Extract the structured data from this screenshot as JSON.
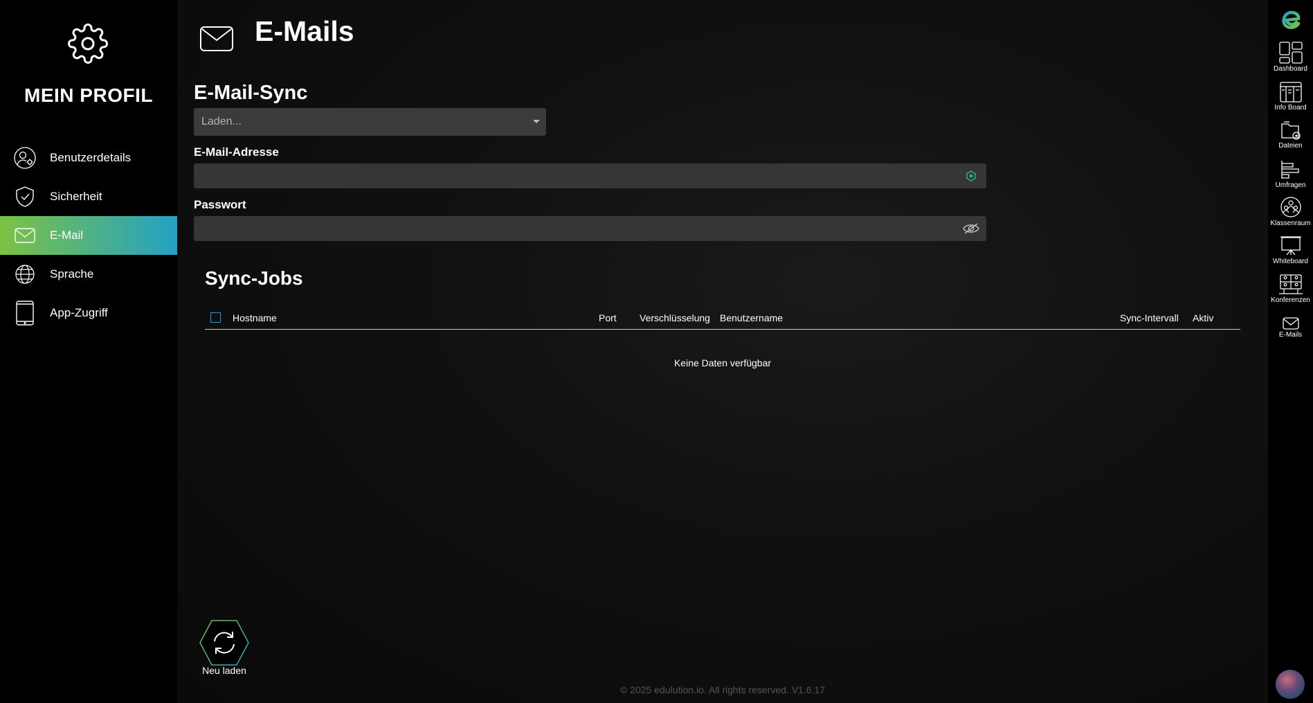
{
  "sidebar": {
    "title": "MEIN PROFIL",
    "items": [
      {
        "label": "Benutzerdetails",
        "icon": "user-gear-icon"
      },
      {
        "label": "Sicherheit",
        "icon": "shield-check-icon"
      },
      {
        "label": "E-Mail",
        "icon": "mail-icon",
        "active": true
      },
      {
        "label": "Sprache",
        "icon": "globe-icon"
      },
      {
        "label": "App-Zugriff",
        "icon": "tablet-icon"
      }
    ]
  },
  "header": {
    "title": "E-Mails",
    "icon": "mail-icon"
  },
  "email_sync": {
    "title": "E-Mail-Sync",
    "select_value": "Laden...",
    "email_label": "E-Mail-Adresse",
    "email_value": "",
    "password_label": "Passwort",
    "password_value": ""
  },
  "sync_jobs": {
    "title": "Sync-Jobs",
    "columns": [
      "Hostname",
      "Port",
      "Verschlüsselung",
      "Benutzername",
      "Sync-Intervall",
      "Aktiv"
    ],
    "empty_message": "Keine Daten verfügbar"
  },
  "reload_button": {
    "label": "Neu laden",
    "icon": "refresh-icon"
  },
  "footer": "© 2025 edulution.io. All rights reserved. V1.6.17",
  "rail": {
    "items": [
      {
        "label": "Dashboard",
        "icon": "dashboard-icon"
      },
      {
        "label": "Info Board",
        "icon": "info-board-icon"
      },
      {
        "label": "Dateien",
        "icon": "files-icon"
      },
      {
        "label": "Umfragen",
        "icon": "surveys-icon"
      },
      {
        "label": "Klassenraum",
        "icon": "classroom-icon"
      },
      {
        "label": "Whiteboard",
        "icon": "whiteboard-icon"
      },
      {
        "label": "Konferenzen",
        "icon": "conferences-icon"
      },
      {
        "label": "E-Mails",
        "icon": "mail-icon"
      }
    ]
  },
  "colors": {
    "accent_start": "#7cc242",
    "accent_end": "#24a1c6",
    "checkbox": "#2a9ad0"
  }
}
